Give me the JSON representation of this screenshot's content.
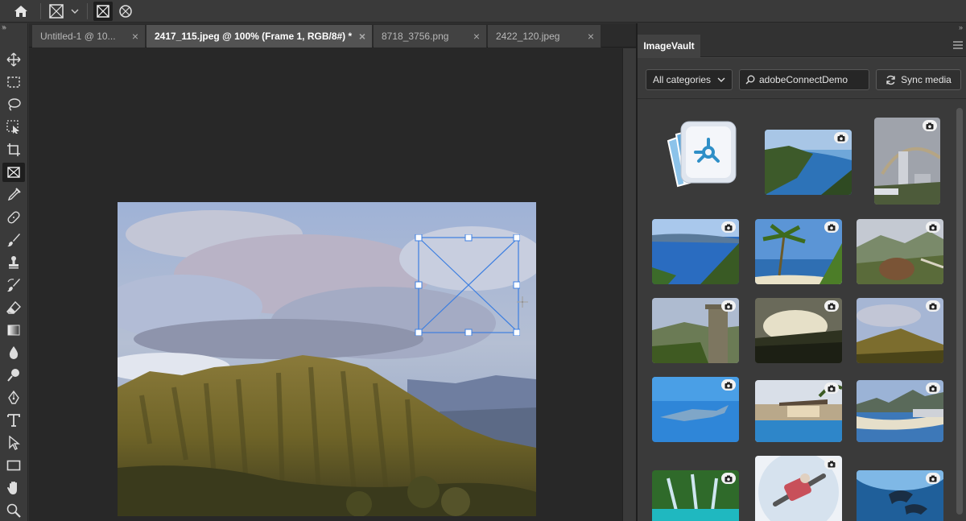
{
  "options_bar": {
    "icons": [
      "home-icon",
      "frame-tool-preset-icon",
      "chevron-down-icon",
      "rectangle-frame-icon",
      "ellipse-frame-icon"
    ]
  },
  "toolbar": {
    "collapse_label": "»",
    "tools": [
      "move",
      "rectangular-marquee",
      "lasso",
      "object-selection",
      "crop",
      "frame",
      "eyedropper",
      "spot-healing",
      "brush",
      "clone-stamp",
      "history-brush",
      "eraser",
      "gradient",
      "blur",
      "dodge",
      "pen",
      "type",
      "path-selection",
      "rectangle",
      "hand",
      "zoom"
    ],
    "active_tool": "frame"
  },
  "document": {
    "tabs": [
      {
        "label": "Untitled-1 @ 10...",
        "close": "×",
        "active": false
      },
      {
        "label": "2417_115.jpeg @ 100% (Frame 1, RGB/8#) *",
        "close": "×",
        "active": true
      },
      {
        "label": "8718_3756.png",
        "close": "×",
        "active": false
      },
      {
        "label": "2422_120.jpeg",
        "close": "×",
        "active": false
      }
    ],
    "tabs_collapse_label": "»"
  },
  "panel": {
    "collapse_label": "»",
    "tab_label": "ImageVault",
    "category_dropdown": "All categories",
    "search_value": "adobeConnectDemo",
    "sync_button": "Sync media",
    "thumbnails": [
      {
        "name": "imagevault-logo",
        "camera": false
      },
      {
        "name": "coastal-cliff",
        "camera": true
      },
      {
        "name": "city-rainbow",
        "camera": true
      },
      {
        "name": "ocean-coast",
        "camera": true
      },
      {
        "name": "palm-beach",
        "camera": true
      },
      {
        "name": "mountain-barrel",
        "camera": true
      },
      {
        "name": "cliff-tower",
        "camera": true
      },
      {
        "name": "sunset-valley",
        "camera": true
      },
      {
        "name": "green-ridge",
        "camera": true
      },
      {
        "name": "underwater-shark",
        "camera": true
      },
      {
        "name": "pool-house",
        "camera": true
      },
      {
        "name": "beach-city",
        "camera": true
      },
      {
        "name": "waterfall",
        "camera": true
      },
      {
        "name": "snowboarder",
        "camera": true
      },
      {
        "name": "diving-dolphins",
        "camera": true
      }
    ]
  },
  "colors": {
    "frame_selection": "#3d7fe0",
    "app_background": "#282828",
    "panel_background": "#3a3a3a"
  }
}
